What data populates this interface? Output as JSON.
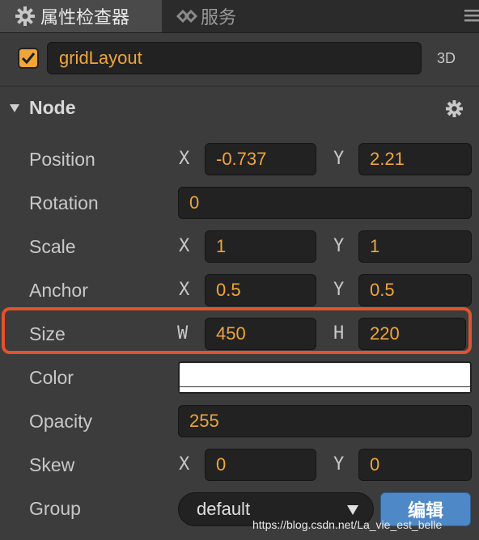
{
  "tabs": {
    "inspector_label": "属性检查器",
    "services_label": "服务"
  },
  "node_header": {
    "enabled": true,
    "name": "gridLayout",
    "mode_label": "3D"
  },
  "section": {
    "title": "Node"
  },
  "properties": {
    "position": {
      "label": "Position",
      "x_axis": "X",
      "x": "-0.737",
      "y_axis": "Y",
      "y": "2.21"
    },
    "rotation": {
      "label": "Rotation",
      "value": "0"
    },
    "scale": {
      "label": "Scale",
      "x_axis": "X",
      "x": "1",
      "y_axis": "Y",
      "y": "1"
    },
    "anchor": {
      "label": "Anchor",
      "x_axis": "X",
      "x": "0.5",
      "y_axis": "Y",
      "y": "0.5"
    },
    "size": {
      "label": "Size",
      "w_axis": "W",
      "w": "450",
      "h_axis": "H",
      "h": "220"
    },
    "color": {
      "label": "Color",
      "value": "#ffffff"
    },
    "opacity": {
      "label": "Opacity",
      "value": "255"
    },
    "skew": {
      "label": "Skew",
      "x_axis": "X",
      "x": "0",
      "y_axis": "Y",
      "y": "0"
    },
    "group": {
      "label": "Group",
      "selected": "default",
      "edit_label": "编辑"
    }
  },
  "watermark": "https://blog.csdn.net/La_vie_est_belle",
  "colors": {
    "accent": "#f0a53a",
    "highlight": "#e2532b",
    "button_blue": "#4f88c6",
    "panel_bg": "#3c3c3c"
  }
}
